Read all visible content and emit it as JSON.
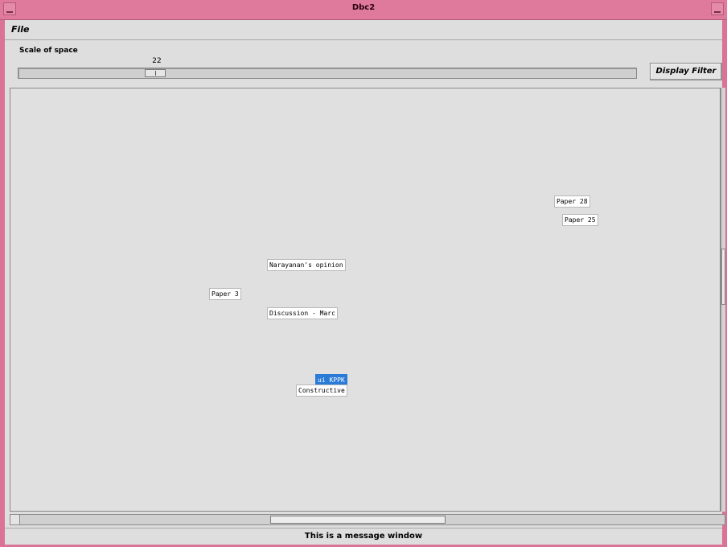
{
  "window": {
    "title": "Dbc2"
  },
  "menubar": {
    "file_label": "File"
  },
  "scale": {
    "label": "Scale of space",
    "value": "22",
    "slider_fraction": 0.22
  },
  "toolbar": {
    "display_filter_label": "Display Filter"
  },
  "nodes": [
    {
      "label": "Paper 28"
    },
    {
      "label": "Paper 25"
    },
    {
      "label": "Narayanan's opinion"
    },
    {
      "label": "Paper 3"
    },
    {
      "label": "Discussion - Marc"
    },
    {
      "label": "ui KPPK"
    },
    {
      "label": "Constructive"
    }
  ],
  "status": {
    "message": "This is a message window"
  },
  "colors": {
    "titlebar": "#e07a9c",
    "selection": "#2a7bd8"
  }
}
